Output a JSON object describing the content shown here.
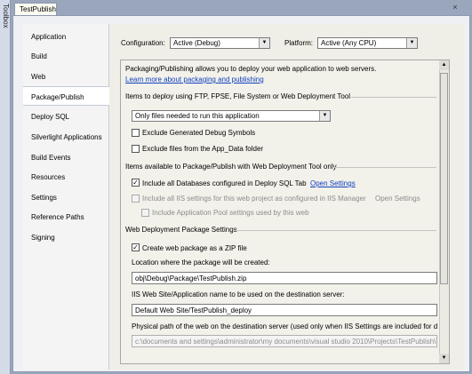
{
  "window": {
    "toolbox_label": "Toolbox",
    "tab_title": "TestPublish",
    "close_glyph": "×"
  },
  "nav": {
    "items": [
      {
        "label": "Application"
      },
      {
        "label": "Build"
      },
      {
        "label": "Web"
      },
      {
        "label": "Package/Publish"
      },
      {
        "label": "Deploy SQL"
      },
      {
        "label": "Silverlight Applications"
      },
      {
        "label": "Build Events"
      },
      {
        "label": "Resources"
      },
      {
        "label": "Settings"
      },
      {
        "label": "Reference Paths"
      },
      {
        "label": "Signing"
      }
    ],
    "selected": "Package/Publish"
  },
  "top": {
    "configuration_label": "Configuration:",
    "configuration_value": "Active (Debug)",
    "platform_label": "Platform:",
    "platform_value": "Active (Any CPU)"
  },
  "panel": {
    "intro": "Packaging/Publishing allows you to deploy your web application to web servers.",
    "learn_more": "Learn more about packaging and publishing",
    "section1": {
      "title": "Items to deploy using FTP, FPSE, File System or Web Deployment Tool",
      "dropdown_value": "Only files needed to run this application",
      "exclude_debug": "Exclude Generated Debug Symbols",
      "exclude_app_data": "Exclude files from the App_Data folder"
    },
    "section2": {
      "title": "Items available to Package/Publish with Web Deployment Tool only",
      "include_db": "Include all Databases configured in Deploy SQL Tab",
      "open_settings_link": "Open Settings",
      "include_iis": "Include all IIS settings for this web project as configured in IIS Manager",
      "open_settings_disabled": "Open Settings",
      "include_pool": "Include Application Pool settings used by this web"
    },
    "section3": {
      "title": "Web Deployment Package Settings",
      "create_zip": "Create web package as a ZIP file",
      "location_label": "Location where the package will be created:",
      "location_value": "obj\\Debug\\Package\\TestPublish.zip",
      "iis_site_label": "IIS Web Site/Application name to be used on the destination server:",
      "iis_site_value": "Default Web Site/TestPublish_deploy",
      "physical_path_label": "Physical path of the web on the destination server (used only when IIS Settings are included for de",
      "physical_path_value": "c:\\documents and settings\\administrator\\my documents\\visual studio 2010\\Projects\\TestPublish\\Test"
    },
    "checks": {
      "exclude_debug": false,
      "exclude_app_data": false,
      "include_db": true,
      "include_iis": false,
      "include_pool": false,
      "create_zip": true
    }
  }
}
